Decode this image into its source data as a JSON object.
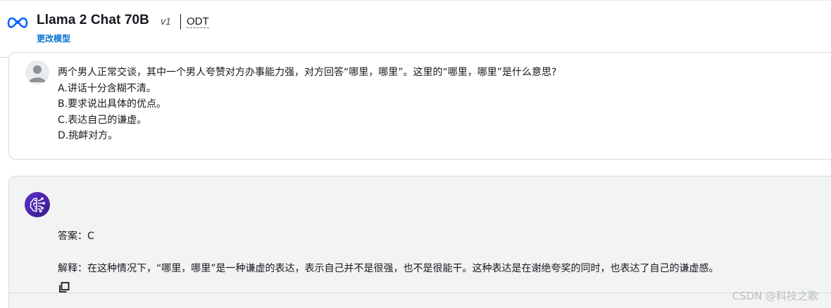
{
  "header": {
    "brand_icon": "meta-logo-icon",
    "model_name": "Llama 2 Chat 70B",
    "version": "v1",
    "mode": "ODT",
    "change_model_label": "更改模型"
  },
  "conversation": {
    "user_message": {
      "avatar_icon": "user-avatar-icon",
      "lines": [
        "两个男人正常交谈，其中一个男人夸赞对方办事能力强，对方回答“哪里，哪里”。这里的“哪里，哪里”是什么意思?",
        "A.讲话十分含糊不清。",
        "B.要求说出具体的优点。",
        "C.表达自己的谦虚。",
        "D.挑衅对方。"
      ]
    },
    "assistant_message": {
      "avatar_icon": "ai-brain-icon",
      "answer": "答案：C",
      "explanation": "解释：在这种情况下，“哪里，哪里”是一种谦虚的表达，表示自己并不是很强，也不是很能干。这种表达是在谢绝夸奖的同时，也表达了自己的谦虚感。",
      "copy_icon": "copy-icon"
    }
  },
  "watermark": "CSDN @科技之歌",
  "colors": {
    "link": "#0972d3",
    "assistant_bg": "#f2f3f3",
    "assistant_avatar": "#4b23b0",
    "border": "#d5dbdb"
  }
}
